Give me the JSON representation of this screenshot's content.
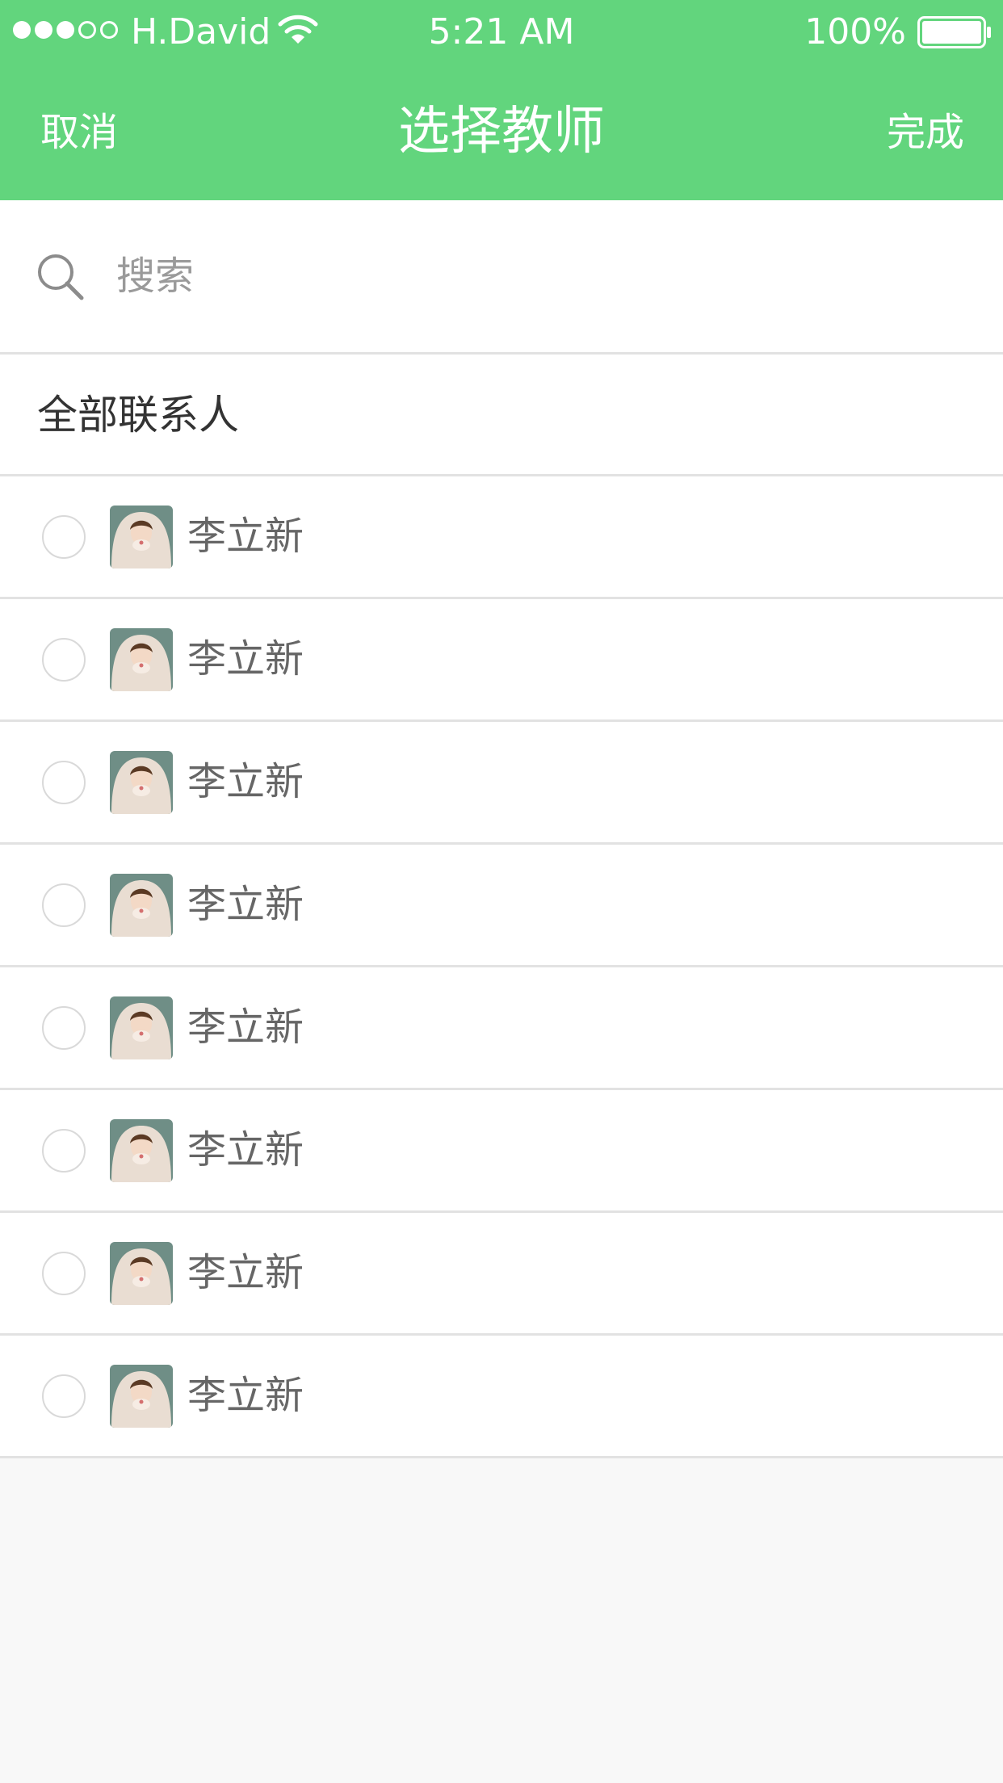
{
  "status_bar": {
    "carrier": "H.David",
    "time": "5:21 AM",
    "battery": "100%"
  },
  "nav": {
    "cancel_label": "取消",
    "title": "选择教师",
    "done_label": "完成"
  },
  "search": {
    "placeholder": "搜索"
  },
  "section": {
    "title": "全部联系人"
  },
  "contacts": [
    {
      "name": "李立新"
    },
    {
      "name": "李立新"
    },
    {
      "name": "李立新"
    },
    {
      "name": "李立新"
    },
    {
      "name": "李立新"
    },
    {
      "name": "李立新"
    },
    {
      "name": "李立新"
    },
    {
      "name": "李立新"
    }
  ],
  "colors": {
    "header": "#62d57d",
    "background": "#f8f8f8",
    "divider": "#e2e2e2"
  },
  "icons": [
    "signal-icon",
    "wifi-icon",
    "battery-icon",
    "search-icon",
    "radio-unchecked-icon",
    "avatar"
  ]
}
